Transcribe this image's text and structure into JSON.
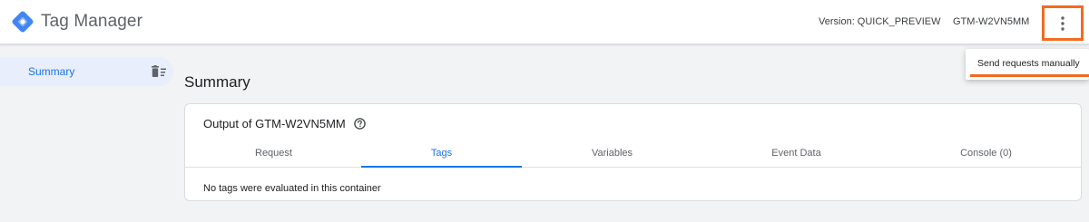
{
  "header": {
    "app_title": "Tag Manager",
    "version_text": "Version: QUICK_PREVIEW",
    "container_id": "GTM-W2VN5MM",
    "more_icon": "more-vert-icon"
  },
  "sidebar": {
    "items": [
      {
        "label": "Summary",
        "icon": "delete-sweep-icon",
        "selected": true
      }
    ]
  },
  "main": {
    "page_title": "Summary",
    "card": {
      "title": "Output of GTM-W2VN5MM",
      "help_icon": "help-icon",
      "tabs": [
        {
          "label": "Request",
          "active": false
        },
        {
          "label": "Tags",
          "active": true
        },
        {
          "label": "Variables",
          "active": false
        },
        {
          "label": "Event Data",
          "active": false
        },
        {
          "label": "Console (0)",
          "active": false
        }
      ],
      "empty_message": "No tags were evaluated in this container"
    }
  },
  "menu": {
    "items": [
      {
        "label": "Send requests manually"
      }
    ]
  },
  "colors": {
    "accent": "#1a73e8",
    "highlight": "#f26b21",
    "sidebar_selected": "#e8eefb",
    "background": "#f1f3f4"
  }
}
